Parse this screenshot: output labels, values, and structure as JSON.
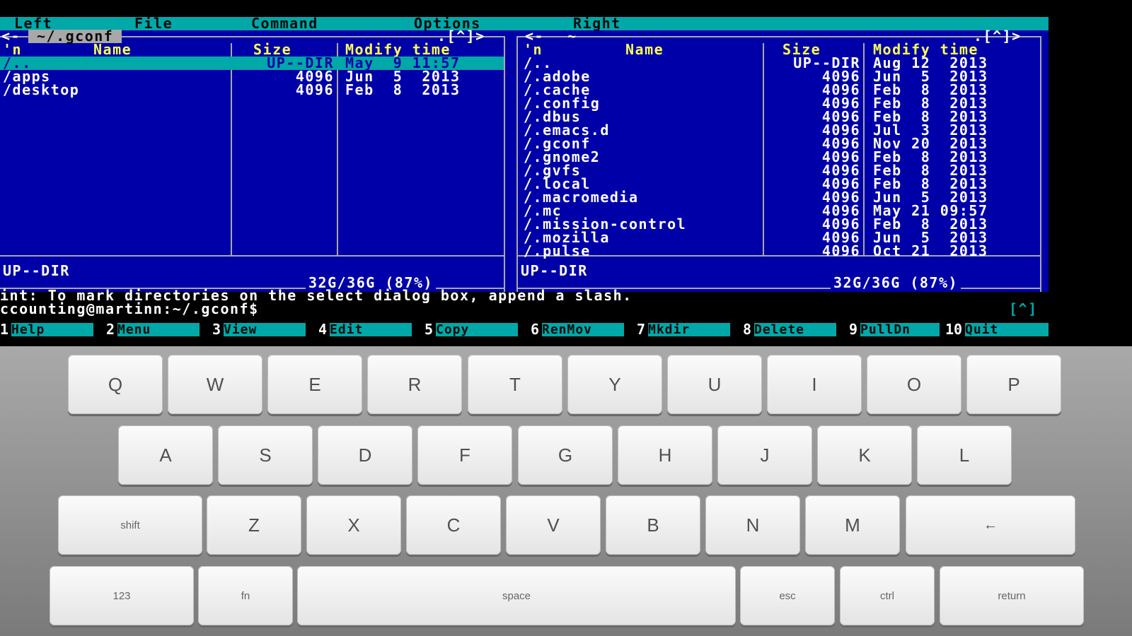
{
  "menubar": {
    "items": [
      "Left",
      "File",
      "Command",
      "Options",
      "Right"
    ]
  },
  "left_panel": {
    "path": "~/.gconf",
    "corner": ".[^]>",
    "arrow": "<-",
    "headers": {
      "n": "'n",
      "name": "Name",
      "size": "Size",
      "mtime": "Modify time"
    },
    "rows": [
      {
        "name": "/..",
        "size": "UP--DIR",
        "mtime": "May  9 11:57",
        "selected": true
      },
      {
        "name": "/apps",
        "size": "4096",
        "mtime": "Jun  5  2013"
      },
      {
        "name": "/desktop",
        "size": "4096",
        "mtime": "Feb  8  2013"
      }
    ],
    "status": "UP--DIR",
    "disk": "32G/36G (87%)"
  },
  "right_panel": {
    "path": "~",
    "corner": ".[^]>",
    "arrow": "<-",
    "headers": {
      "n": "'n",
      "name": "Name",
      "size": "Size",
      "mtime": "Modify time"
    },
    "rows": [
      {
        "name": "/..",
        "size": "UP--DIR",
        "mtime": "Aug 12  2013"
      },
      {
        "name": "/.adobe",
        "size": "4096",
        "mtime": "Jun  5  2013"
      },
      {
        "name": "/.cache",
        "size": "4096",
        "mtime": "Feb  8  2013"
      },
      {
        "name": "/.config",
        "size": "4096",
        "mtime": "Feb  8  2013"
      },
      {
        "name": "/.dbus",
        "size": "4096",
        "mtime": "Feb  8  2013"
      },
      {
        "name": "/.emacs.d",
        "size": "4096",
        "mtime": "Jul  3  2013"
      },
      {
        "name": "/.gconf",
        "size": "4096",
        "mtime": "Nov 20  2013"
      },
      {
        "name": "/.gnome2",
        "size": "4096",
        "mtime": "Feb  8  2013"
      },
      {
        "name": "/.gvfs",
        "size": "4096",
        "mtime": "Feb  8  2013"
      },
      {
        "name": "/.local",
        "size": "4096",
        "mtime": "Feb  8  2013"
      },
      {
        "name": "/.macromedia",
        "size": "4096",
        "mtime": "Jun  5  2013"
      },
      {
        "name": "/.mc",
        "size": "4096",
        "mtime": "May 21 09:57"
      },
      {
        "name": "/.mission-control",
        "size": "4096",
        "mtime": "Feb  8  2013"
      },
      {
        "name": "/.mozilla",
        "size": "4096",
        "mtime": "Jun  5  2013"
      },
      {
        "name": "/.pulse",
        "size": "4096",
        "mtime": "Oct 21  2013"
      }
    ],
    "status": "UP--DIR",
    "disk": "32G/36G (87%)"
  },
  "hint": "int: To mark directories on the select dialog box, append a slash.",
  "prompt": "ccounting@martinn:~/.gconf$",
  "prompt_corner": "[^]",
  "fkeys": [
    {
      "num": "1",
      "label": "Help"
    },
    {
      "num": "2",
      "label": "Menu"
    },
    {
      "num": "3",
      "label": "View"
    },
    {
      "num": "4",
      "label": "Edit"
    },
    {
      "num": "5",
      "label": "Copy"
    },
    {
      "num": "6",
      "label": "RenMov"
    },
    {
      "num": "7",
      "label": "Mkdir"
    },
    {
      "num": "8",
      "label": "Delete"
    },
    {
      "num": "9",
      "label": "PullDn"
    },
    {
      "num": "10",
      "label": "Quit"
    }
  ],
  "keyboard": {
    "row1": [
      "Q",
      "W",
      "E",
      "R",
      "T",
      "Y",
      "U",
      "I",
      "O",
      "P"
    ],
    "row2": [
      "A",
      "S",
      "D",
      "F",
      "G",
      "H",
      "J",
      "K",
      "L"
    ],
    "row3": [
      "shift",
      "Z",
      "X",
      "C",
      "V",
      "B",
      "N",
      "M",
      "←"
    ],
    "row4": [
      "123",
      "fn",
      "space",
      "esc",
      "ctrl",
      "return"
    ]
  },
  "colors": {
    "panel_bg": "#0000a8",
    "header_text": "#ffff54",
    "accent_cyan": "#00a8a8"
  }
}
